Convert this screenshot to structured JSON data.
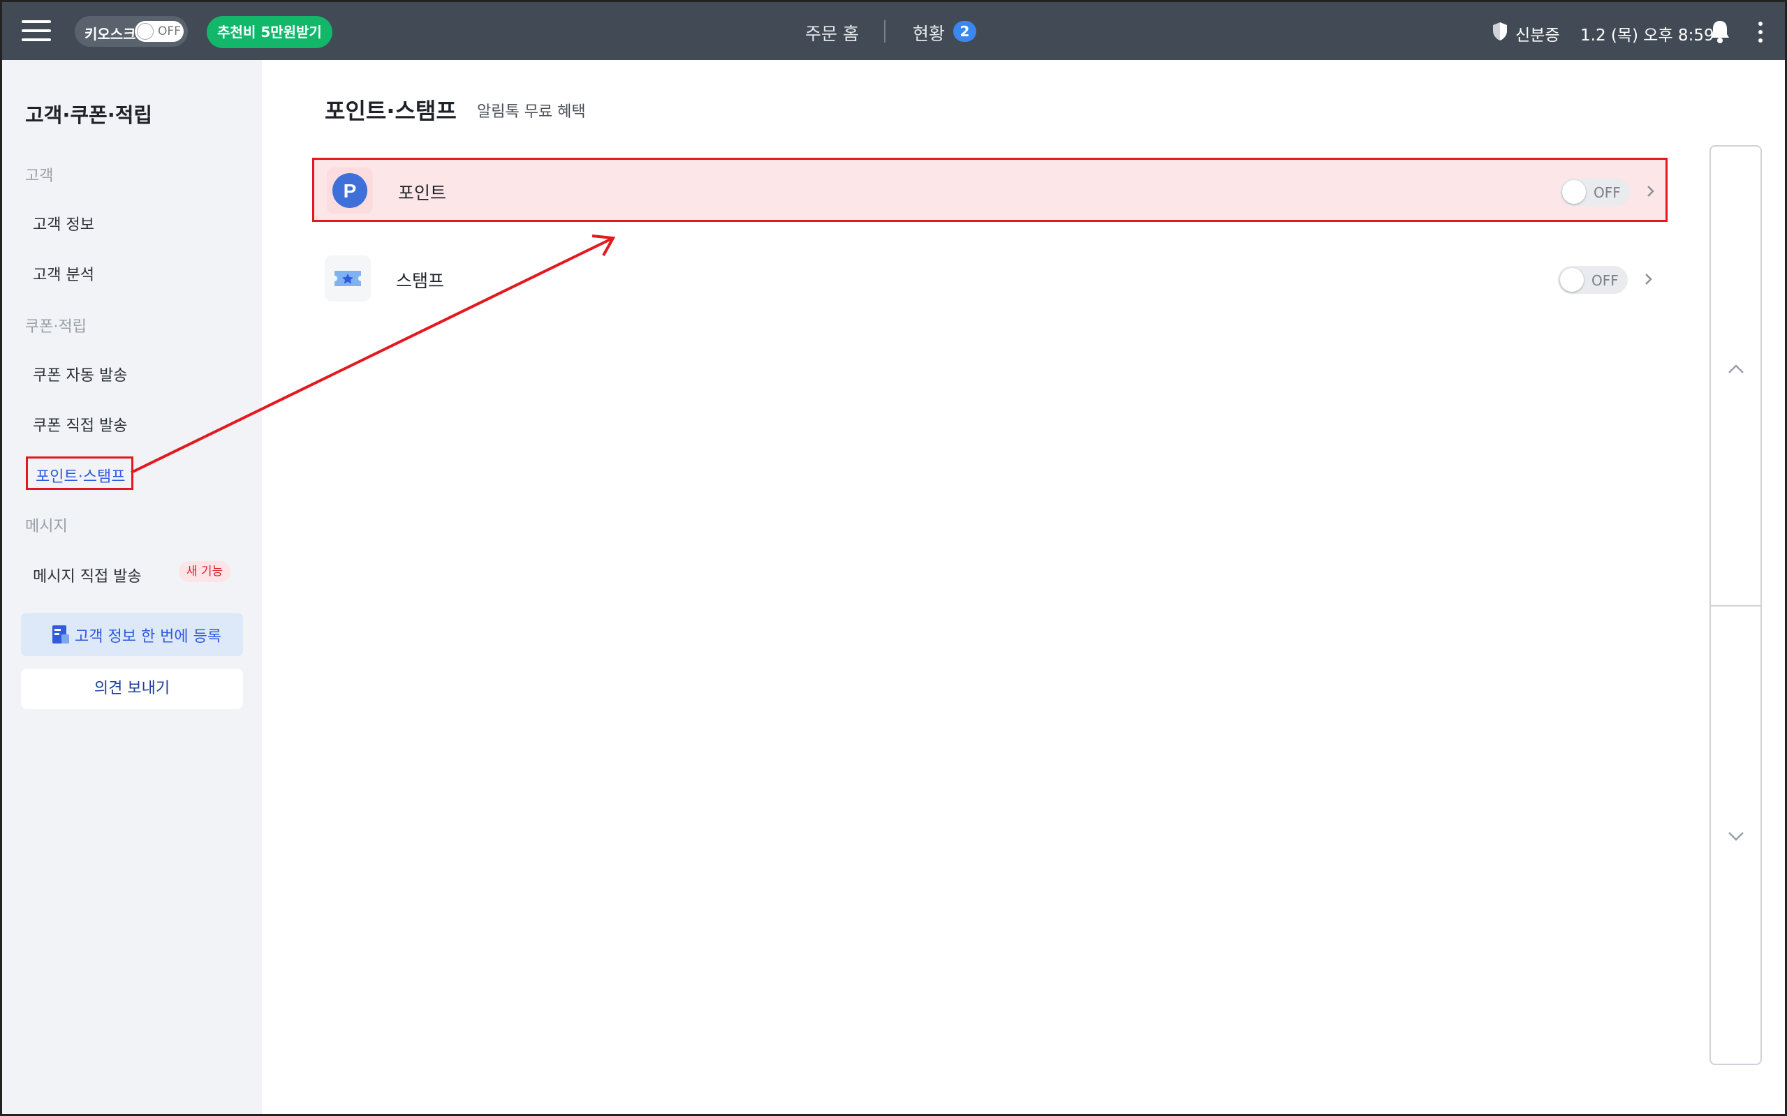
{
  "topbar": {
    "kiosk_label": "키오스크",
    "kiosk_toggle": "OFF",
    "promo_label": "추천비 5만원받기",
    "nav_home": "주문 홈",
    "nav_status": "현황",
    "nav_status_count": "2",
    "auth_label": "신분증",
    "datetime": "1.2 (목) 오후 8:59"
  },
  "sidebar": {
    "title": "고객·쿠폰·적립",
    "sections": [
      {
        "label": "고객",
        "items": [
          "고객 정보",
          "고객 분석"
        ]
      },
      {
        "label": "쿠폰·적립",
        "items": [
          "쿠폰 자동 발송",
          "쿠폰 직접 발송",
          "포인트·스탬프"
        ]
      },
      {
        "label": "메시지",
        "items": [
          "메시지 직접 발송"
        ]
      }
    ],
    "active_item": "포인트·스탬프",
    "new_badge": "새 기능",
    "register_button": "고객 정보 한 번에 등록",
    "feedback_button": "의견 보내기"
  },
  "main": {
    "title": "포인트·스탬프",
    "subtitle": "알림톡 무료 혜택",
    "rows": [
      {
        "label": "포인트",
        "icon": "point-icon",
        "toggle": "OFF",
        "highlighted": true
      },
      {
        "label": "스탬프",
        "icon": "stamp-icon",
        "toggle": "OFF",
        "highlighted": false
      }
    ],
    "point_icon_letter": "P"
  },
  "colors": {
    "topbar_bg": "#424b55",
    "sidebar_bg": "#f1f3f6",
    "promo_green": "#12b76a",
    "badge_blue": "#3a87f0",
    "active_blue": "#2f5bdc",
    "annotation_red": "#e3191f",
    "highlight_bg": "#fde6e7"
  }
}
